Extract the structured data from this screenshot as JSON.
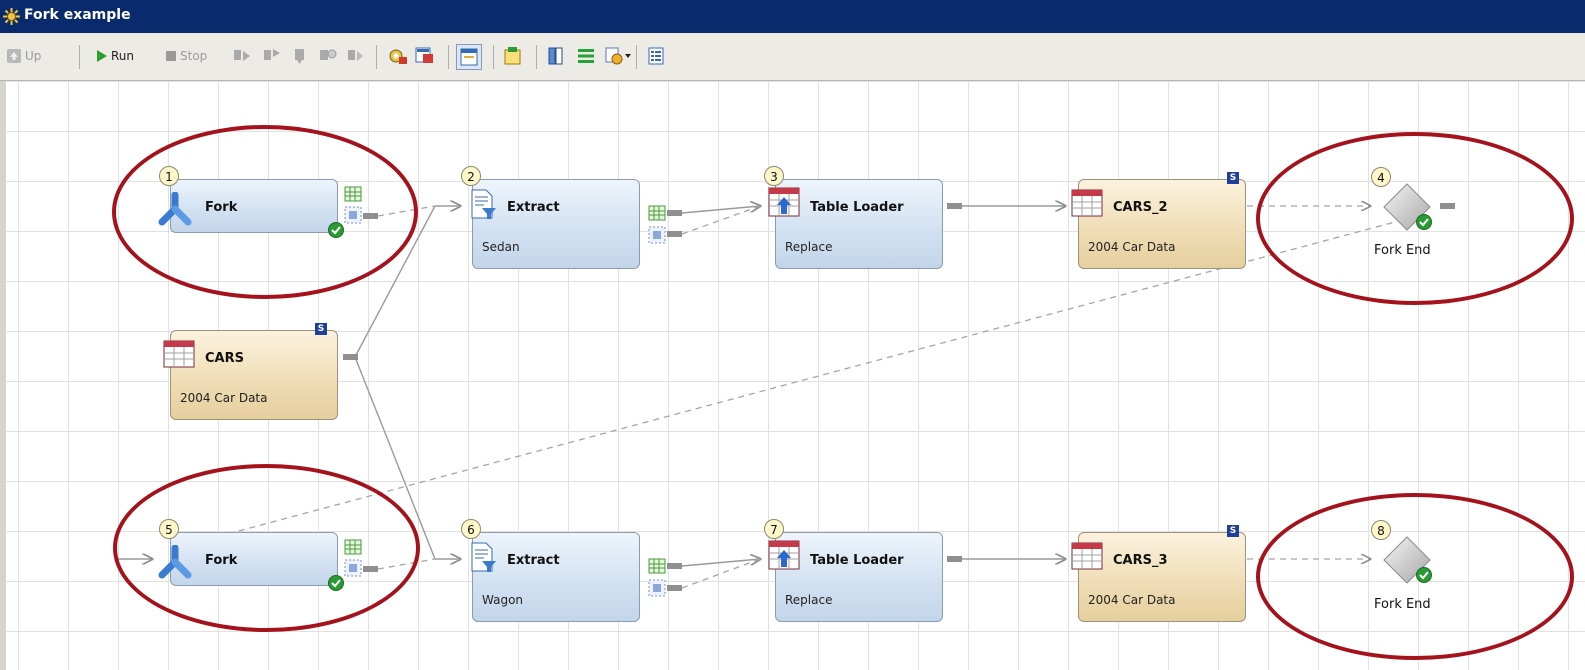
{
  "window": {
    "title": "Fork example"
  },
  "toolbar": {
    "up_label": "Up",
    "run_label": "Run",
    "stop_label": "Stop"
  },
  "nodes": {
    "fork1": {
      "number": "1",
      "title": "Fork"
    },
    "extract2": {
      "number": "2",
      "title": "Extract",
      "sub": "Sedan"
    },
    "loader3": {
      "number": "3",
      "title": "Table Loader",
      "sub": "Replace"
    },
    "cars2": {
      "title": "CARS_2",
      "sub": "2004 Car Data",
      "badge": "S"
    },
    "forkend4": {
      "number": "4",
      "label": "Fork End"
    },
    "cars": {
      "title": "CARS",
      "sub": "2004 Car Data",
      "badge": "S"
    },
    "fork5": {
      "number": "5",
      "title": "Fork"
    },
    "extract6": {
      "number": "6",
      "title": "Extract",
      "sub": "Wagon"
    },
    "loader7": {
      "number": "7",
      "title": "Table Loader",
      "sub": "Replace"
    },
    "cars3": {
      "title": "CARS_3",
      "sub": "2004 Car Data",
      "badge": "S"
    },
    "forkend8": {
      "number": "8",
      "label": "Fork End"
    }
  },
  "colors": {
    "titlebar": "#0a2a6e",
    "highlight": "#a4121b",
    "transform": "#d3e2f2",
    "table": "#efdcb4"
  }
}
